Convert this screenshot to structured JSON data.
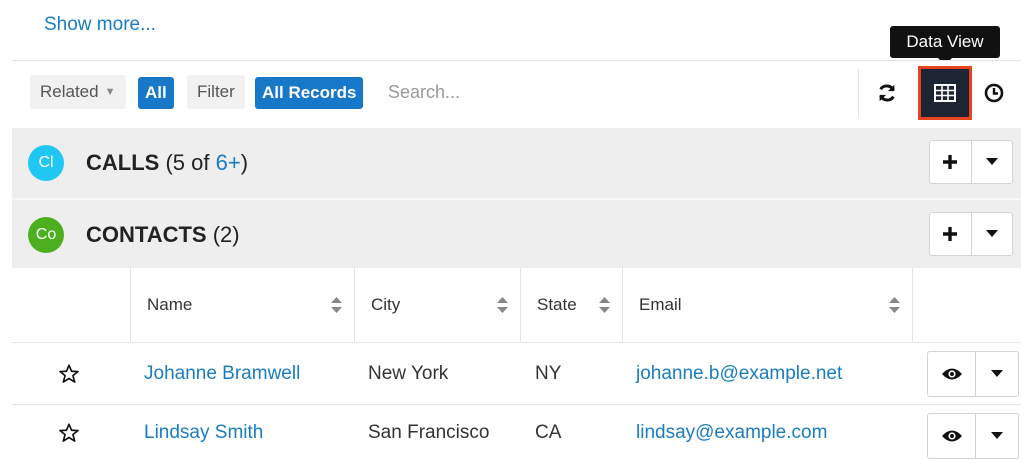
{
  "show_more": "Show more...",
  "tooltip": "Data View",
  "toolbar": {
    "related_label": "Related",
    "related_value": "All",
    "filter_label": "Filter",
    "filter_value": "All Records",
    "search_placeholder": "Search...",
    "icons": [
      "refresh-icon",
      "data-view-icon",
      "activity-stream-icon"
    ],
    "highlight_color": "#e8431e"
  },
  "panels": [
    {
      "badge": "Cl",
      "badge_color": "#1fc7f2",
      "title": "CALLS",
      "count_prefix": "(5 of ",
      "count_link": "6+",
      "count_suffix": ")"
    },
    {
      "badge": "Co",
      "badge_color": "#4caf1f",
      "title": "CONTACTS",
      "count_prefix": "(2)",
      "count_link": "",
      "count_suffix": ""
    }
  ],
  "table": {
    "columns": [
      "Name",
      "City",
      "State",
      "Email"
    ],
    "rows": [
      {
        "name": "Johanne Bramwell",
        "city": "New York",
        "state": "NY",
        "email": "johanne.b@example.net"
      },
      {
        "name": "Lindsay Smith",
        "city": "San Francisco",
        "state": "CA",
        "email": "lindsay@example.com"
      }
    ]
  }
}
